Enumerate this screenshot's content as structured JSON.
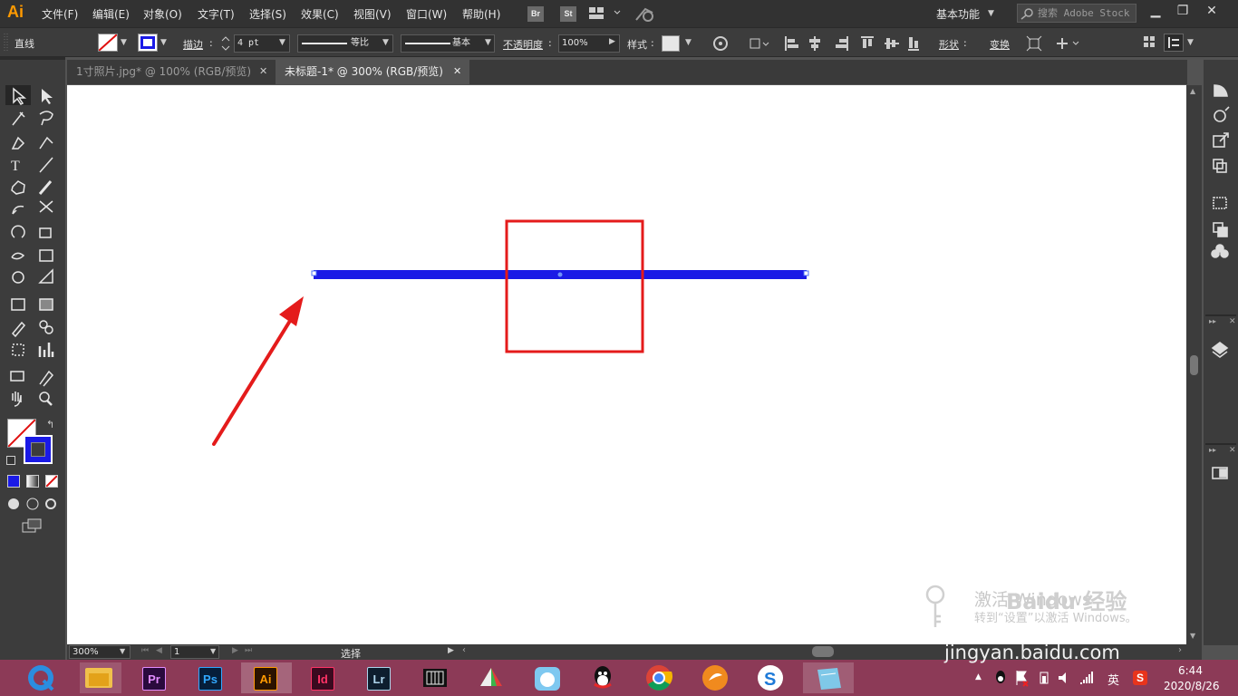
{
  "app": {
    "logo": "Ai",
    "menu": [
      "文件(F)",
      "编辑(E)",
      "对象(O)",
      "文字(T)",
      "选择(S)",
      "效果(C)",
      "视图(V)",
      "窗口(W)",
      "帮助(H)"
    ],
    "bridge_label": "Br",
    "stock_label": "St",
    "workspace": "基本功能",
    "search_placeholder": "搜索 Adobe Stock"
  },
  "control_bar": {
    "selection_type": "直线",
    "stroke_label": "描边",
    "stroke_weight": "4 pt",
    "profile_label": "等比",
    "brush_label": "基本",
    "opacity_label": "不透明度",
    "opacity_value": "100%",
    "style_label": "样式",
    "shape_label": "形状",
    "transform_label": "变换"
  },
  "tabs": [
    {
      "label": "1寸照片.jpg* @ 100% (RGB/预览)",
      "active": false
    },
    {
      "label": "未标题-1* @ 300% (RGB/预览)",
      "active": true
    }
  ],
  "canvas": {
    "line_color": "#1a1ae6",
    "annotation_color": "#e41b1b"
  },
  "status_bar": {
    "zoom": "300%",
    "artboard": "1",
    "tool_status": "选择"
  },
  "watermarks": {
    "activate_title": "激活 Windows",
    "activate_sub": "转到“设置”以激活 Windows。",
    "baidu_brand": "Baidu 经验",
    "baidu_url": "jingyan.baidu.com"
  },
  "taskbar": {
    "apps": [
      "Pr",
      "Ps",
      "Ai",
      "Id",
      "Lr"
    ],
    "ime": "英",
    "time": "6:44",
    "date": "2020/8/26"
  }
}
